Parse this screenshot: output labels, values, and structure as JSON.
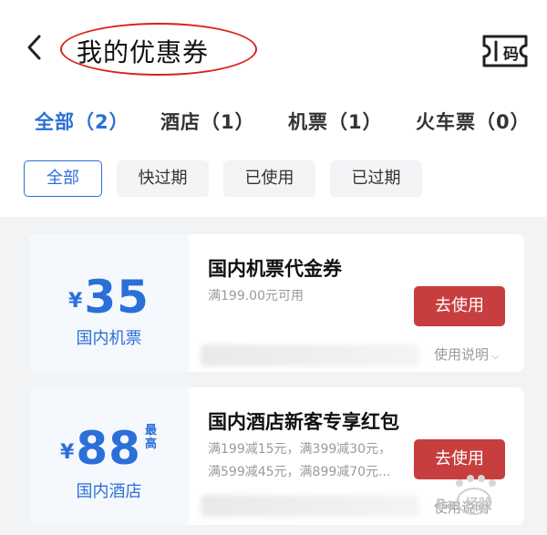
{
  "header": {
    "title": "我的优惠券",
    "code_label": "码"
  },
  "tabs": [
    {
      "label": "全部（2）",
      "active": true
    },
    {
      "label": "酒店（1）",
      "active": false
    },
    {
      "label": "机票（1）",
      "active": false
    },
    {
      "label": "火车票（0）",
      "active": false
    }
  ],
  "filters": [
    {
      "label": "全部",
      "active": true
    },
    {
      "label": "快过期",
      "active": false
    },
    {
      "label": "已使用",
      "active": false
    },
    {
      "label": "已过期",
      "active": false
    }
  ],
  "coupons": [
    {
      "currency": "¥",
      "amount": "35",
      "category": "国内机票",
      "title": "国内机票代金券",
      "conditions": [
        "满199.00元可用"
      ],
      "button": "去使用",
      "help": "使用说明"
    },
    {
      "currency": "¥",
      "amount": "88",
      "max_label": "最高",
      "category": "国内酒店",
      "title": "国内酒店新客专享红包",
      "conditions": [
        "满199减15元，满399减30元，",
        "满599减45元，满899减70元..."
      ],
      "button": "去使用",
      "help": "使用说明"
    }
  ],
  "colors": {
    "accent": "#2b6fd8",
    "button": "#c73e3e",
    "highlight": "#d8201f"
  },
  "watermark": "Bai 经验"
}
